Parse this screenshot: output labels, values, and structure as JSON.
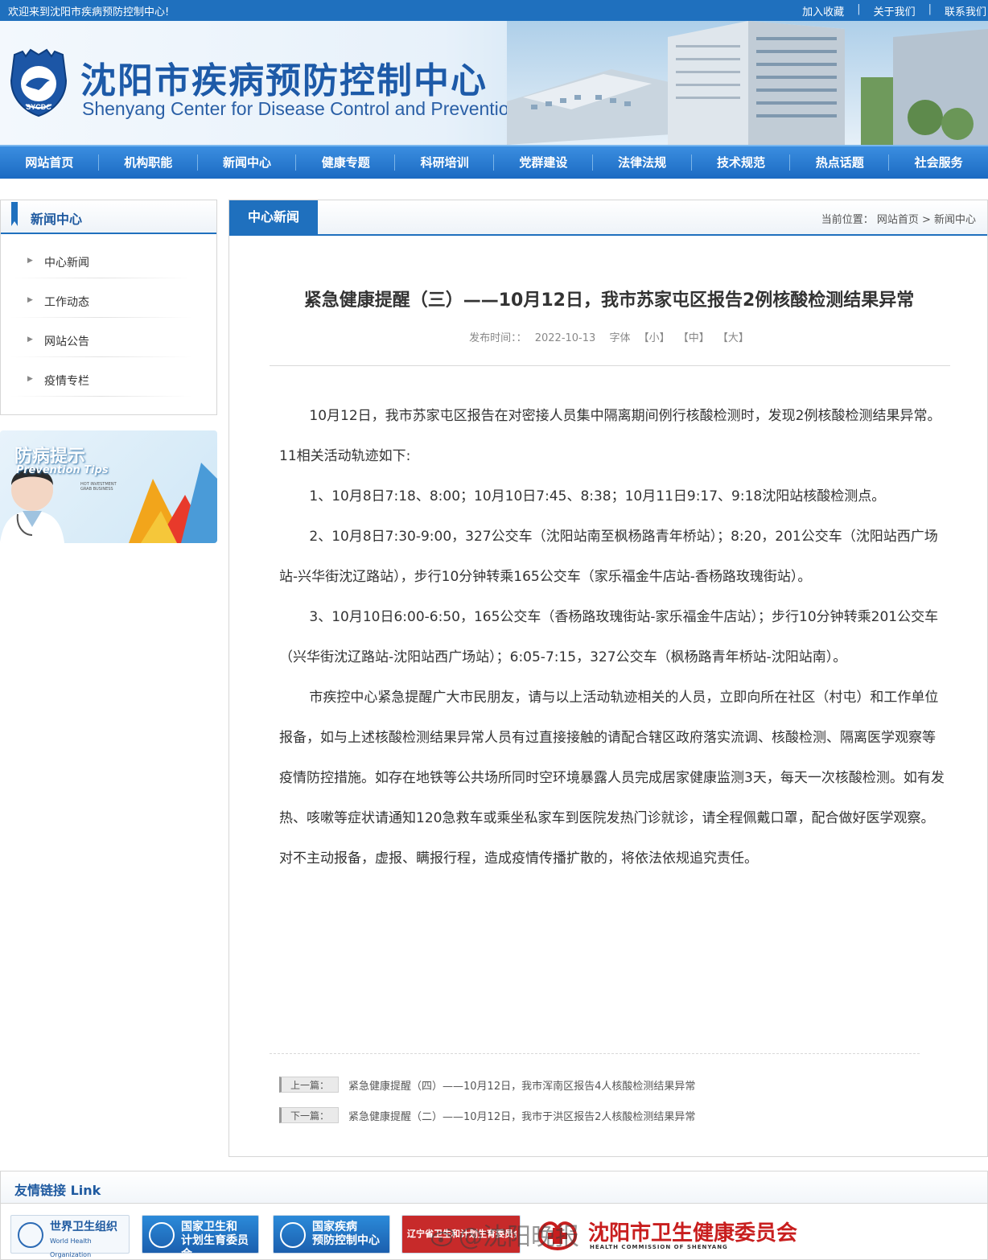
{
  "topbar": {
    "welcome": "欢迎来到沈阳市疾病预防控制中心!",
    "links": [
      "加入收藏",
      "关于我们",
      "联系我们"
    ],
    "separator": "|"
  },
  "header": {
    "title_cn": "沈阳市疾病预防控制中心",
    "title_en": "Shenyang Center for Disease Control and Prevention",
    "logo_text": "SYCDC"
  },
  "nav": [
    "网站首页",
    "机构职能",
    "新闻中心",
    "健康专题",
    "科研培训",
    "党群建设",
    "法律法规",
    "技术规范",
    "热点话题",
    "社会服务"
  ],
  "sidebar": {
    "title": "新闻中心",
    "items": [
      "中心新闻",
      "工作动态",
      "网站公告",
      "疫情专栏"
    ],
    "tips_title": "防病提示",
    "tips_en": "Prevention Tips",
    "tips_small": "HOT INVESTMENT GRAB BUSINESS"
  },
  "main": {
    "tab": "中心新闻",
    "breadcrumb": "当前位置：  网站首页 > 新闻中心",
    "title": "紧急健康提醒（三）——10月12日，我市苏家屯区报告2例核酸检测结果异常",
    "meta_label": "发布时间：：",
    "meta_date": "2022-10-13",
    "meta_font": "字体",
    "meta_small": "【小】",
    "meta_mid": "【中】",
    "meta_large": "【大】",
    "paragraphs": [
      "10月12日，我市苏家屯区报告在对密接人员集中隔离期间例行核酸检测时，发现2例核酸检测结果异常。",
      "11相关活动轨迹如下:",
      "1、10月8日7:18、8:00；10月10日7:45、8:38；10月11日9:17、9:18沈阳站核酸检测点。",
      "2、10月8日7:30-9:00，327公交车（沈阳站南至枫杨路青年桥站）；8:20，201公交车（沈阳站西广场站-兴华街沈辽路站），步行10分钟转乘165公交车（家乐福金牛店站-香杨路玫瑰街站）。",
      "3、10月10日6:00-6:50，165公交车（香杨路玫瑰街站-家乐福金牛店站）；步行10分钟转乘201公交车（兴华街沈辽路站-沈阳站西广场站）；6:05-7:15，327公交车（枫杨路青年桥站-沈阳站南）。",
      "市疾控中心紧急提醒广大市民朋友，请与以上活动轨迹相关的人员，立即向所在社区（村屯）和工作单位报备，如与上述核酸检测结果异常人员有过直接接触的请配合辖区政府落实流调、核酸检测、隔离医学观察等疫情防控措施。如存在地铁等公共场所同时空环境暴露人员完成居家健康监测3天，每天一次核酸检测。如有发热、咳嗽等症状请通知120急救车或乘坐私家车到医院发热门诊就诊，请全程佩戴口罩，配合做好医学观察。对不主动报备，虚报、瞒报行程，造成疫情传播扩散的，将依法依规追究责任。"
    ],
    "prev_label": "上一篇：",
    "prev_title": "紧急健康提醒（四）——10月12日，我市浑南区报告4人核酸检测结果异常",
    "next_label": "下一篇：",
    "next_title": "紧急健康提醒（二）——10月12日，我市于洪区报告2人核酸检测结果异常"
  },
  "friend_links": {
    "title": "友情链接 Link",
    "who_cn": "世界卫生组织",
    "who_en": "World Health Organization",
    "nhfpc_1": "国家卫生和",
    "nhfpc_2": "计划生育委员会",
    "cdc_1": "国家疾病",
    "cdc_2": "预防控制中心",
    "ln_1": "辽宁省卫生和计划生育委员会",
    "wjw_cn": "沈阳市卫生健康委员会",
    "wjw_en": "HEALTH COMMISSION OF SHENYANG",
    "watermark": "@沈阳晚报"
  }
}
